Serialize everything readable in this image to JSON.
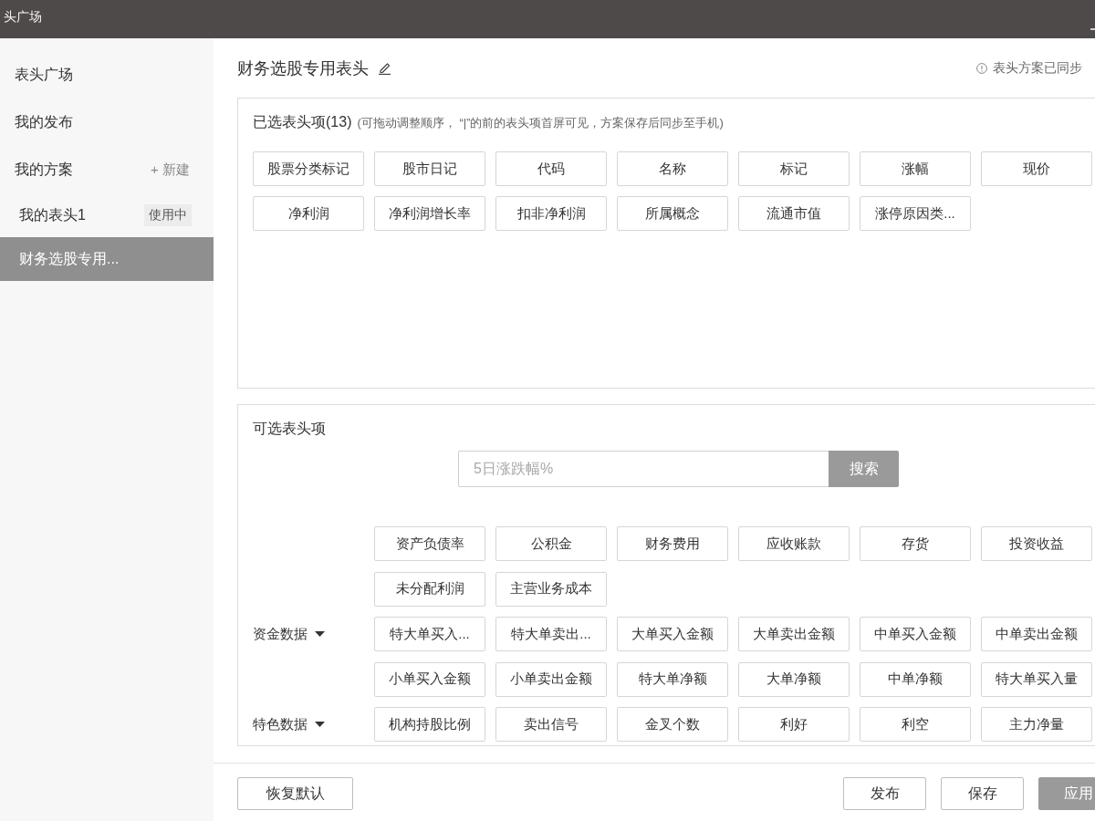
{
  "window": {
    "title": "头广场"
  },
  "sidebar": {
    "items": [
      {
        "label": "表头广场",
        "selected": false
      },
      {
        "label": "我的发布",
        "selected": false
      },
      {
        "label": "我的方案",
        "selected": false,
        "action": "+ 新建",
        "children": [
          {
            "label": "我的表头1",
            "badge": "使用中",
            "selected": false
          },
          {
            "label": "财务选股专用...",
            "selected": true
          }
        ]
      }
    ]
  },
  "header": {
    "title": "财务选股专用表头",
    "sync_notice": "表头方案已同步"
  },
  "selected_panel": {
    "title": "已选表头项(13)",
    "hint": "(可拖动调整顺序， “|”的前的表头项首屏可见，方案保存后同步至手机)",
    "items": [
      "股票分类标记",
      "股市日记",
      "代码",
      "名称",
      "标记",
      "涨幅",
      "现价",
      "净利润",
      "净利润增长率",
      "扣非净利润",
      "所属概念",
      "流通市值",
      "涨停原因类..."
    ]
  },
  "available_panel": {
    "title": "可选表头项",
    "search": {
      "placeholder": "5日涨跌幅%",
      "button": "搜索"
    },
    "groups": [
      {
        "items": [
          "资产负债率",
          "公积金",
          "财务费用",
          "应收账款",
          "存货",
          "投资收益",
          "未分配利润",
          "主营业务成本"
        ]
      },
      {
        "label": "资金数据",
        "items": [
          "特大单买入...",
          "特大单卖出...",
          "大单买入金额",
          "大单卖出金额",
          "中单买入金额",
          "中单卖出金额",
          "小单买入金额",
          "小单卖出金额",
          "特大单净额",
          "大单净额",
          "中单净额",
          "特大单买入量"
        ]
      },
      {
        "label": "特色数据",
        "items": [
          "机构持股比例",
          "卖出信号",
          "金叉个数",
          "利好",
          "利空",
          "主力净量"
        ]
      }
    ]
  },
  "footer": {
    "left_buttons": [
      {
        "label": "恢复默认",
        "kind": "default"
      }
    ],
    "right_buttons": [
      {
        "label": "发布",
        "kind": "default"
      },
      {
        "label": "保存",
        "kind": "default"
      },
      {
        "label": "应用",
        "kind": "primary"
      }
    ]
  }
}
